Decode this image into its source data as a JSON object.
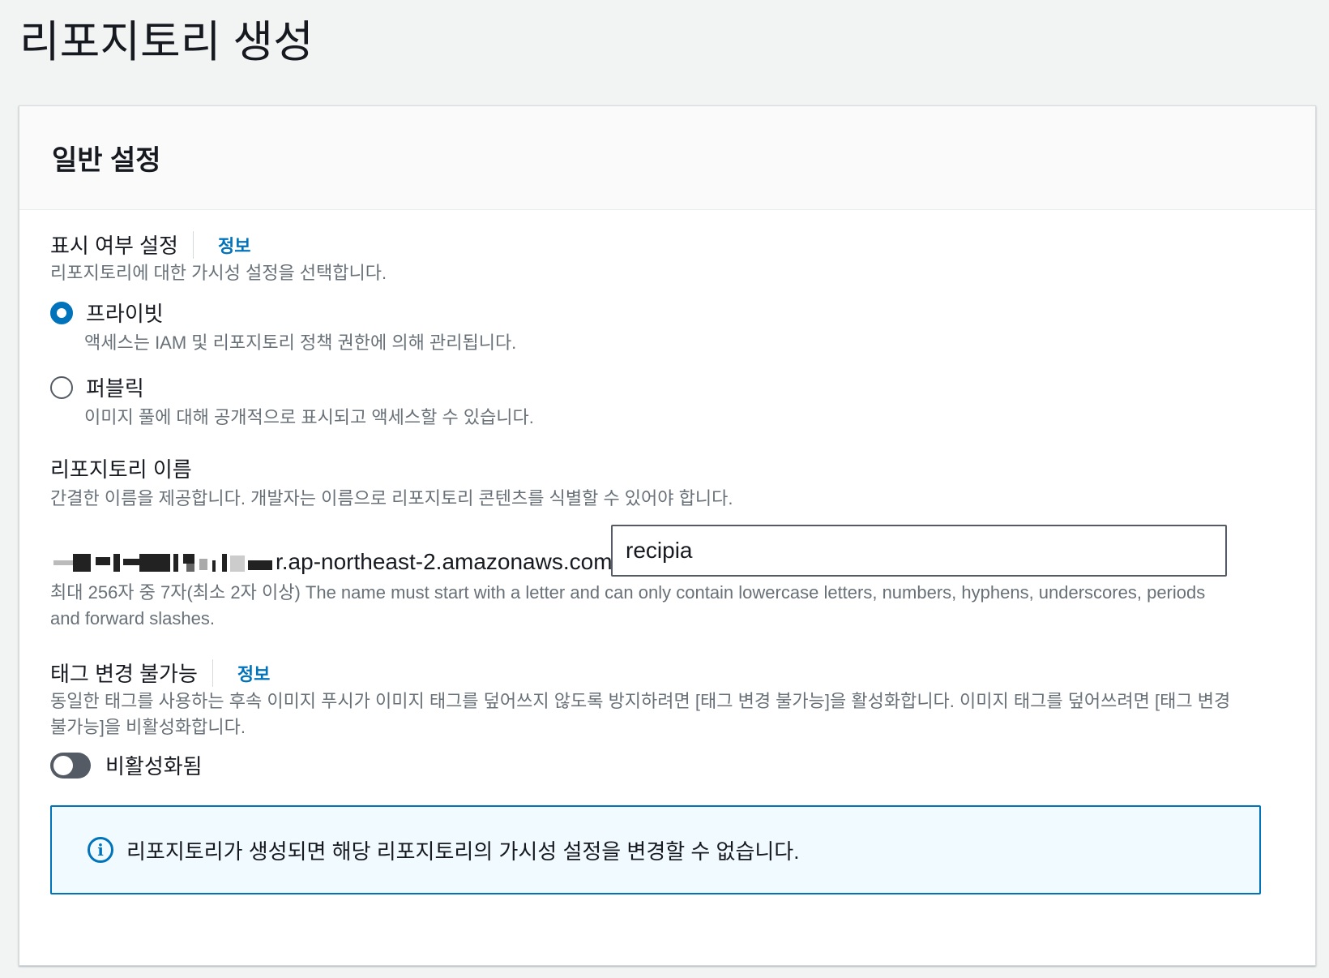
{
  "page": {
    "title": "리포지토리 생성"
  },
  "general": {
    "header": "일반 설정"
  },
  "visibility": {
    "label": "표시 여부 설정",
    "info": "정보",
    "description": "리포지토리에 대한 가시성 설정을 선택합니다.",
    "options": [
      {
        "label": "프라이빗",
        "description": "액세스는 IAM 및 리포지토리 정책 권한에 의해 관리됩니다.",
        "selected": true
      },
      {
        "label": "퍼블릭",
        "description": "이미지 풀에 대해 공개적으로 표시되고 액세스할 수 있습니다.",
        "selected": false
      }
    ]
  },
  "repo_name": {
    "label": "리포지토리 이름",
    "description": "간결한 이름을 제공합니다. 개발자는 이름으로 리포지토리 콘텐츠를 식별할 수 있어야 합니다.",
    "uri_suffix": "r.ap-northeast-2.amazonaws.com/",
    "value": "recipia",
    "constraint": "최대 256자 중 7자(최소 2자 이상) The name must start with a letter and can only contain lowercase letters, numbers, hyphens, underscores, periods and forward slashes."
  },
  "tag_immutability": {
    "label": "태그 변경 불가능",
    "info": "정보",
    "description": "동일한 태그를 사용하는 후속 이미지 푸시가 이미지 태그를 덮어쓰지 않도록 방지하려면 [태그 변경 불가능]을 활성화합니다. 이미지 태그를 덮어쓰려면 [태그 변경 불가능]을 비활성화합니다.",
    "toggle_label": "비활성화됨",
    "enabled": false
  },
  "alert": {
    "text": "리포지토리가 생성되면 해당 리포지토리의 가시성 설정을 변경할 수 없습니다.",
    "icon": "info-icon"
  },
  "colors": {
    "accent": "#0073bb",
    "alert_bg": "#f1faff",
    "text": "#16191f",
    "muted": "#687078"
  }
}
